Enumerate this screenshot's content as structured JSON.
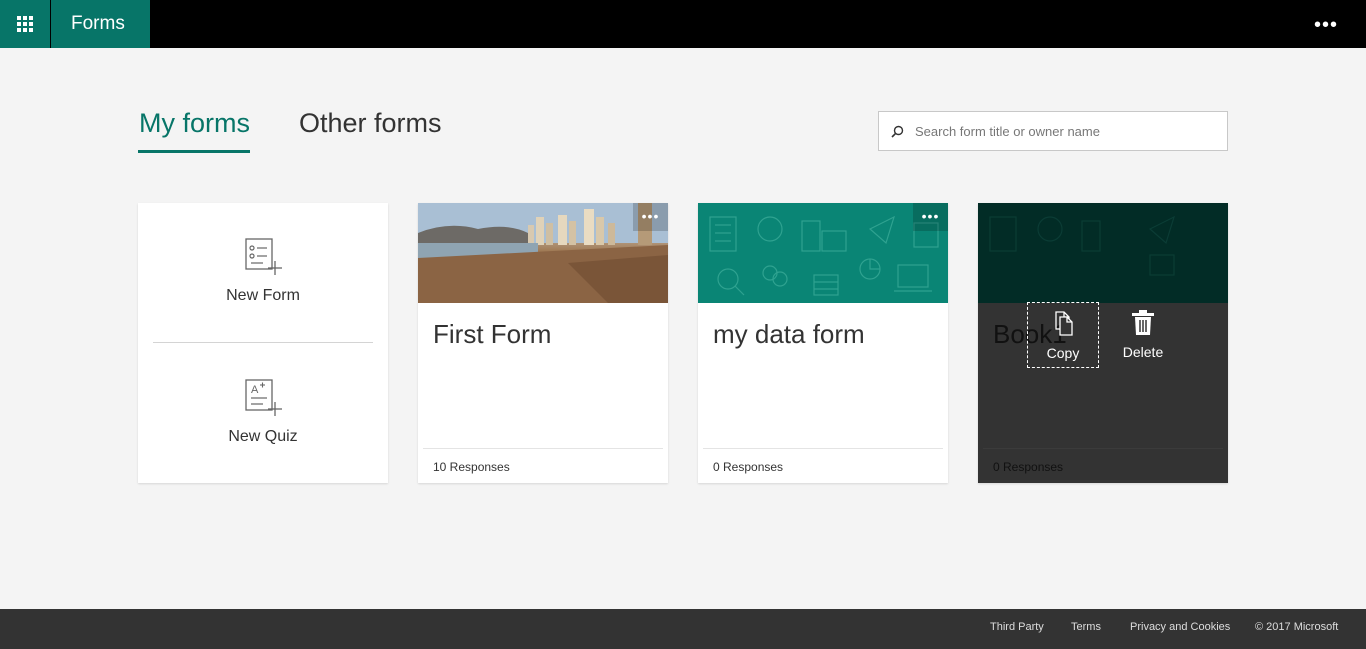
{
  "header": {
    "app_name": "Forms",
    "more_label": "•••"
  },
  "tabs": [
    {
      "label": "My forms",
      "active": true
    },
    {
      "label": "Other forms",
      "active": false
    }
  ],
  "search": {
    "placeholder": "Search form title or owner name"
  },
  "new_card": {
    "new_form_label": "New Form",
    "new_quiz_label": "New Quiz"
  },
  "forms": [
    {
      "title": "First Form",
      "responses": "10 Responses",
      "more": "•••"
    },
    {
      "title": "my data form",
      "responses": "0 Responses",
      "more": "•••"
    },
    {
      "title": "Book1",
      "responses": "0 Responses"
    }
  ],
  "card_actions": {
    "copy_label": "Copy",
    "delete_label": "Delete"
  },
  "footer": {
    "third_party": "Third Party",
    "terms": "Terms",
    "privacy": "Privacy and Cookies",
    "copyright": "© 2017 Microsoft"
  },
  "colors": {
    "brand": "#077568",
    "teal_cover": "#0a8575",
    "topbar": "#000000",
    "footer": "#333333"
  }
}
